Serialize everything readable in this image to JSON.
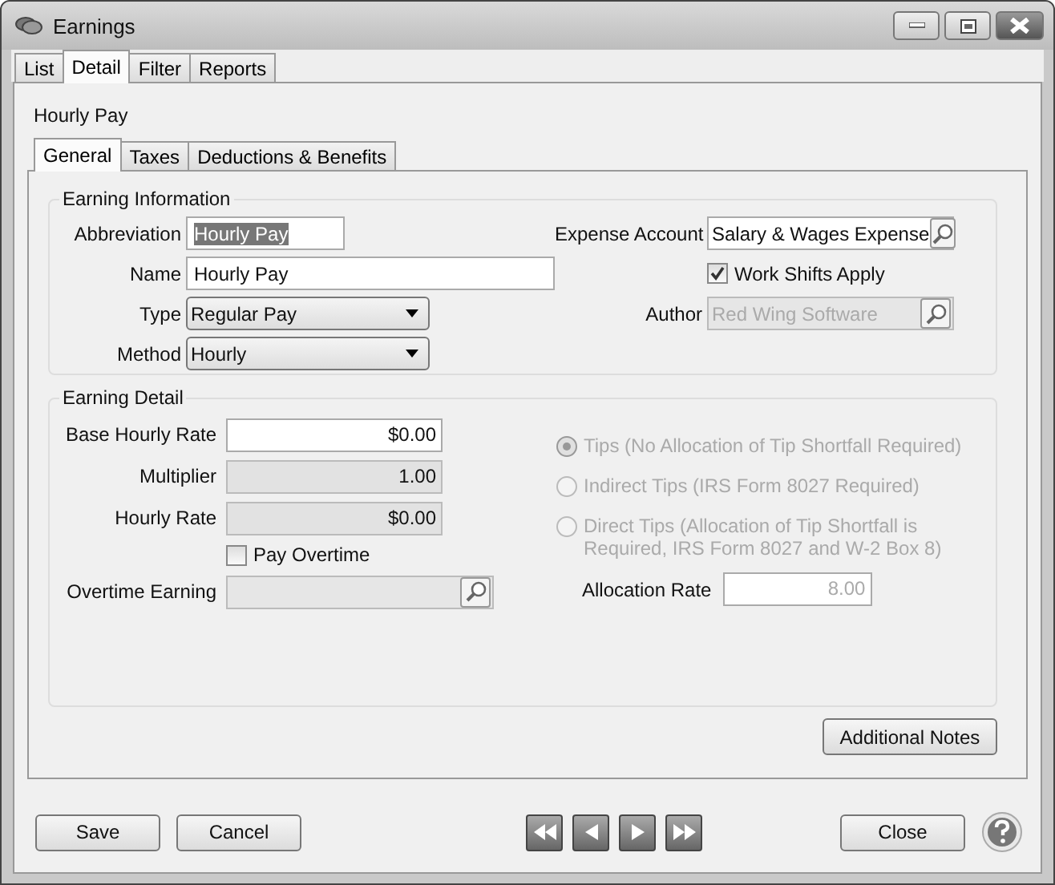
{
  "window": {
    "title": "Earnings"
  },
  "tabs": [
    {
      "label": "List",
      "selected": false
    },
    {
      "label": "Detail",
      "selected": true
    },
    {
      "label": "Filter",
      "selected": false
    },
    {
      "label": "Reports",
      "selected": false
    }
  ],
  "record_title": "Hourly Pay",
  "sub_tabs": [
    {
      "label": "General",
      "selected": true
    },
    {
      "label": "Taxes",
      "selected": false
    },
    {
      "label": "Deductions & Benefits",
      "selected": false
    }
  ],
  "earning_information": {
    "legend": "Earning Information",
    "left_fields": [
      {
        "kind": "text",
        "label": "Abbreviation",
        "value": "Hourly Pay",
        "text_selected": true
      },
      {
        "kind": "text",
        "label": "Name",
        "value": "Hourly Pay",
        "text_selected": false
      },
      {
        "kind": "dropdown",
        "label": "Type",
        "value": "Regular Pay"
      },
      {
        "kind": "dropdown",
        "label": "Method",
        "value": "Hourly"
      }
    ],
    "right_fields": [
      {
        "kind": "lookup",
        "label": "Expense Account",
        "value": "Salary & Wages Expense",
        "disabled": false
      },
      {
        "kind": "checkbox",
        "label": "Work Shifts Apply",
        "checked": true
      },
      {
        "kind": "lookup",
        "label": "Author",
        "value": "Red Wing Software",
        "disabled": true
      }
    ]
  },
  "earning_detail": {
    "legend": "Earning Detail",
    "left_fields": [
      {
        "kind": "number",
        "label": "Base Hourly Rate",
        "value": "$0.00",
        "readonly": false
      },
      {
        "kind": "number",
        "label": "Multiplier",
        "value": "1.00",
        "readonly": true
      },
      {
        "kind": "number",
        "label": "Hourly Rate",
        "value": "$0.00",
        "readonly": true
      },
      {
        "kind": "checkbox",
        "label": "Pay Overtime",
        "checked": false
      },
      {
        "kind": "lookup",
        "label": "Overtime Earning",
        "disabled": true
      }
    ],
    "tip_options": [
      {
        "label": "Tips (No Allocation of Tip Shortfall Required)",
        "selected": true,
        "disabled": true
      },
      {
        "label": "Indirect Tips (IRS Form 8027 Required)",
        "selected": false,
        "disabled": true
      },
      {
        "label": "Direct Tips (Allocation of Tip Shortfall is Required, IRS Form 8027 and W-2 Box 8)",
        "selected": false,
        "disabled": true
      }
    ],
    "allocation_rate": {
      "label": "Allocation Rate",
      "value": "8.00",
      "disabled": true
    }
  },
  "additional_notes_button": "Additional Notes",
  "footer": {
    "left_buttons": [
      "Save",
      "Cancel"
    ],
    "close_button": "Close"
  }
}
